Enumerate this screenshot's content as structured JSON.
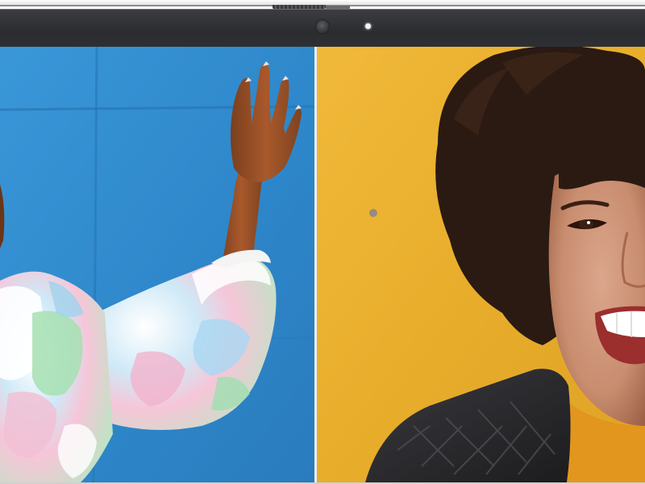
{
  "scene": {
    "description_type": "video-call split view on laptop display",
    "left_tile": {
      "background": "#2f8ed2"
    },
    "right_tile": {
      "background": "#eab12e"
    },
    "bezel": {
      "color": "#2e3033"
    },
    "camera_indicator": {
      "state": "on",
      "color": "#f4f4f4"
    }
  }
}
